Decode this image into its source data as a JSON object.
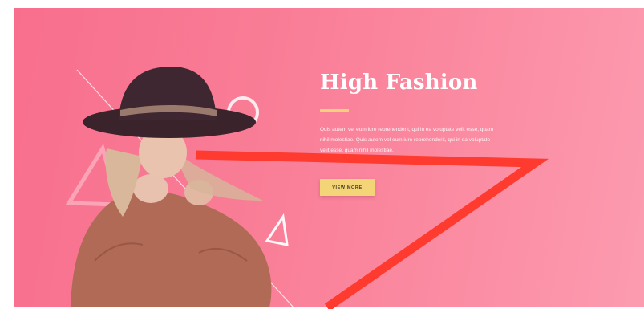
{
  "hero": {
    "title": "High Fashion",
    "body_lines": [
      "Quis autem vel eum iure reprehenderit, qui in ea voluptate velit esse, quam",
      "nihil molestiae. Quis autem vel eum iure reprehenderit, qui in ea voluptate",
      "velit esse, quam nihil molestiae."
    ],
    "button_label": "VIEW MORE"
  },
  "colors": {
    "accent": "#f3d477",
    "hero_background": "#f97d96",
    "overlay_stroke": "#ff3b2f"
  }
}
